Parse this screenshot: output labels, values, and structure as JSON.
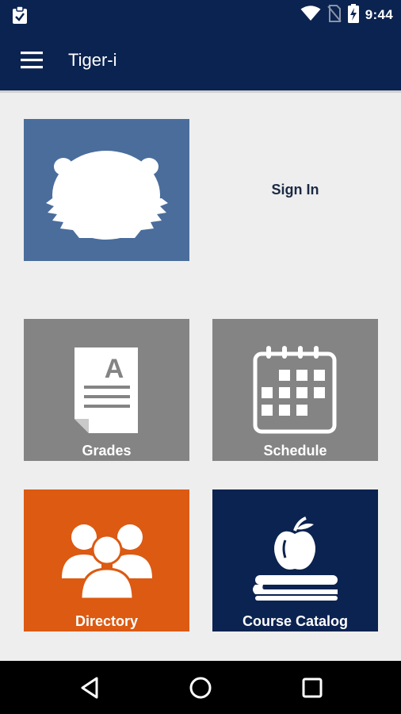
{
  "status_bar": {
    "time": "9:44",
    "icons": [
      "clipboard-check-icon",
      "wifi-icon",
      "no-sim-icon",
      "battery-charging-icon"
    ]
  },
  "app_bar": {
    "menu_icon": "hamburger-menu-icon",
    "title": "Tiger-i"
  },
  "main": {
    "logo_icon": "tiger-head-icon",
    "sign_in_label": "Sign In",
    "tiles": [
      {
        "label": "Grades",
        "icon": "grade-document-icon",
        "color": "#848484"
      },
      {
        "label": "Schedule",
        "icon": "calendar-icon",
        "color": "#848484"
      },
      {
        "label": "Directory",
        "icon": "people-group-icon",
        "color": "#dc5a12"
      },
      {
        "label": "Course Catalog",
        "icon": "apple-on-book-icon",
        "color": "#0b2350"
      }
    ]
  },
  "nav_bar": {
    "buttons": [
      "back-icon",
      "home-icon",
      "recents-icon"
    ]
  },
  "colors": {
    "primary": "#0b2350",
    "logo_tile": "#4a6d9c",
    "background": "#eeeeee"
  }
}
